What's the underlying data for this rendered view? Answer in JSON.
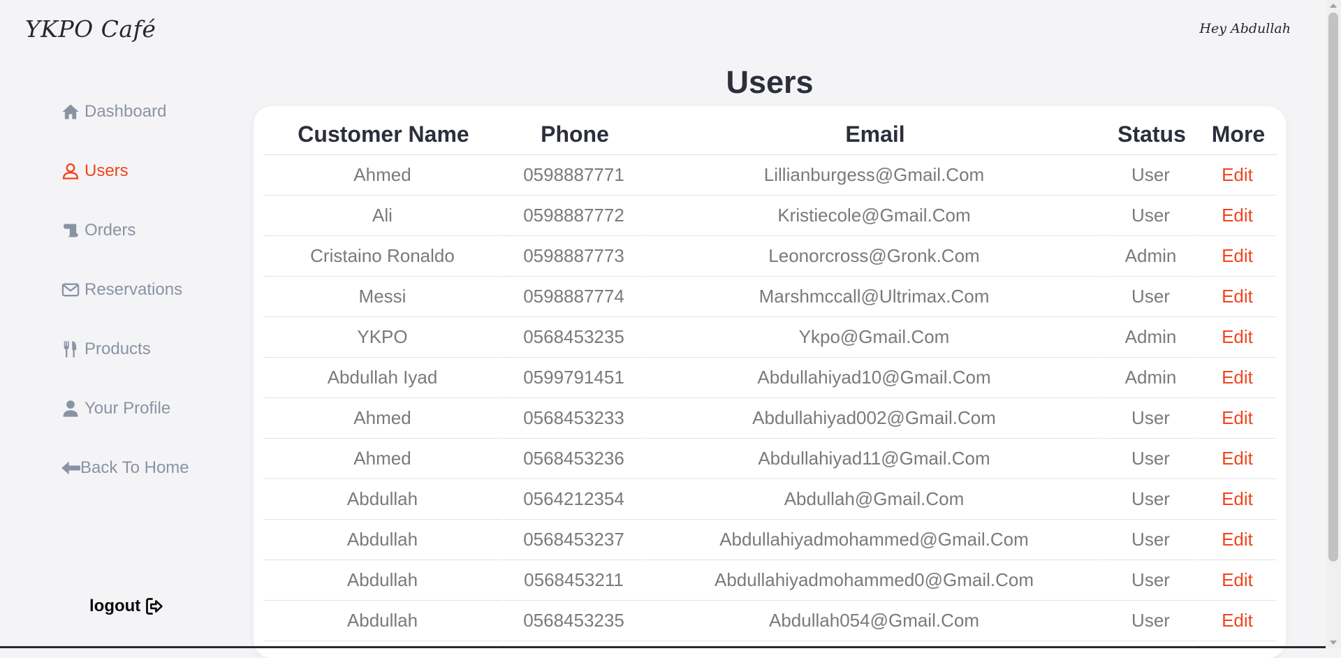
{
  "brand": "YKPO Café",
  "greeting": "Hey Abdullah",
  "sidebar": {
    "items": [
      {
        "label": "Dashboard",
        "icon": "home-icon"
      },
      {
        "label": "Users",
        "icon": "user-outline-icon",
        "active": true
      },
      {
        "label": "Orders",
        "icon": "scroll-icon"
      },
      {
        "label": "Reservations",
        "icon": "envelope-icon"
      },
      {
        "label": "Products",
        "icon": "utensils-icon"
      },
      {
        "label": "Your Profile",
        "icon": "user-icon"
      },
      {
        "label": "Back To Home",
        "icon": "arrow-left-icon"
      }
    ],
    "logout": "logout"
  },
  "page": {
    "title": "Users"
  },
  "table": {
    "headers": [
      "Customer Name",
      "Phone",
      "Email",
      "Status",
      "More"
    ],
    "rows": [
      [
        "Ahmed",
        "0598887771",
        "Lillianburgess@Gmail.Com",
        "User",
        "Edit"
      ],
      [
        "Ali",
        "0598887772",
        "Kristiecole@Gmail.Com",
        "User",
        "Edit"
      ],
      [
        "Cristaino Ronaldo",
        "0598887773",
        "Leonorcross@Gronk.Com",
        "Admin",
        "Edit"
      ],
      [
        "Messi",
        "0598887774",
        "Marshmccall@Ultrimax.Com",
        "User",
        "Edit"
      ],
      [
        "YKPO",
        "0568453235",
        "Ykpo@Gmail.Com",
        "Admin",
        "Edit"
      ],
      [
        "Abdullah Iyad",
        "0599791451",
        "Abdullahiyad10@Gmail.Com",
        "Admin",
        "Edit"
      ],
      [
        "Ahmed",
        "0568453233",
        "Abdullahiyad002@Gmail.Com",
        "User",
        "Edit"
      ],
      [
        "Ahmed",
        "0568453236",
        "Abdullahiyad11@Gmail.Com",
        "User",
        "Edit"
      ],
      [
        "Abdullah",
        "0564212354",
        "Abdullah@Gmail.Com",
        "User",
        "Edit"
      ],
      [
        "Abdullah",
        "0568453237",
        "Abdullahiyadmohammed@Gmail.Com",
        "User",
        "Edit"
      ],
      [
        "Abdullah",
        "0568453211",
        "Abdullahiyadmohammed0@Gmail.Com",
        "User",
        "Edit"
      ],
      [
        "Abdullah",
        "0568453235",
        "Abdullah054@Gmail.Com",
        "User",
        "Edit"
      ]
    ]
  },
  "colors": {
    "accent": "#f2441d",
    "text": "#2c2f3b",
    "muted": "#8a93a3"
  }
}
